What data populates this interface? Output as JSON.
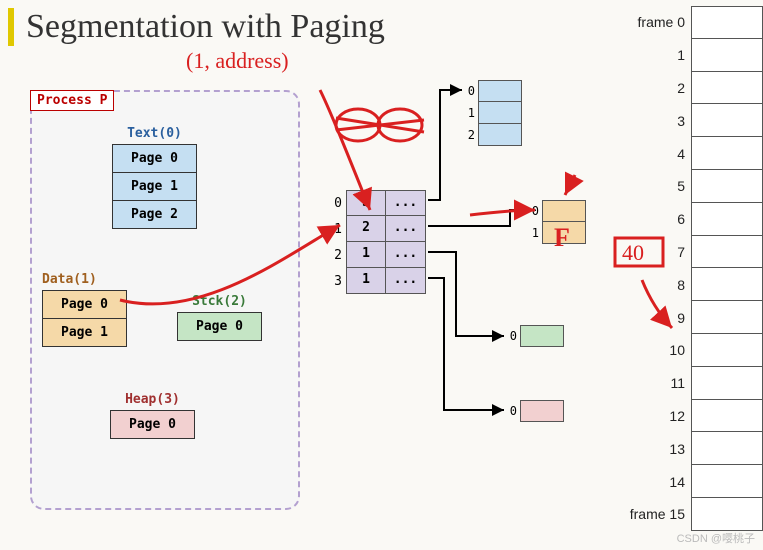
{
  "title": "Segmentation with Paging",
  "process": {
    "label": "Process P",
    "segments": {
      "text": {
        "title": "Text(0)",
        "pages": [
          "Page 0",
          "Page 1",
          "Page 2"
        ]
      },
      "data": {
        "title": "Data(1)",
        "pages": [
          "Page 0",
          "Page 1"
        ]
      },
      "stack": {
        "title": "Stck(2)",
        "pages": [
          "Page 0"
        ]
      },
      "heap": {
        "title": "Heap(3)",
        "pages": [
          "Page 0"
        ]
      }
    }
  },
  "segment_table": {
    "rows": [
      {
        "idx": "0",
        "len": "3",
        "base": "..."
      },
      {
        "idx": "1",
        "len": "2",
        "base": "..."
      },
      {
        "idx": "2",
        "len": "1",
        "base": "..."
      },
      {
        "idx": "3",
        "len": "1",
        "base": "..."
      }
    ]
  },
  "page_tables": {
    "text": {
      "indices": [
        "0",
        "1",
        "2"
      ]
    },
    "data": {
      "indices": [
        "0",
        "1"
      ]
    },
    "stack": {
      "indices": [
        "0"
      ]
    },
    "heap": {
      "indices": [
        "0"
      ]
    }
  },
  "frames": {
    "labels": [
      "frame 0",
      "1",
      "2",
      "3",
      "4",
      "5",
      "6",
      "7",
      "8",
      "9",
      "10",
      "11",
      "12",
      "13",
      "14",
      "frame 15"
    ]
  },
  "annotations": {
    "addr_tuple": "(1, address)",
    "frame_letter": "F",
    "step_label": "40"
  },
  "watermark": "CSDN @嘤桃子",
  "chart_data": {
    "type": "table",
    "description": "Segment table + per-segment page tables feeding physical frame list",
    "segment_table": [
      {
        "segment": 0,
        "name": "Text",
        "pages": 3
      },
      {
        "segment": 1,
        "name": "Data",
        "pages": 2
      },
      {
        "segment": 2,
        "name": "Stack",
        "pages": 1
      },
      {
        "segment": 3,
        "name": "Heap",
        "pages": 1
      }
    ],
    "physical_frames": 16
  }
}
